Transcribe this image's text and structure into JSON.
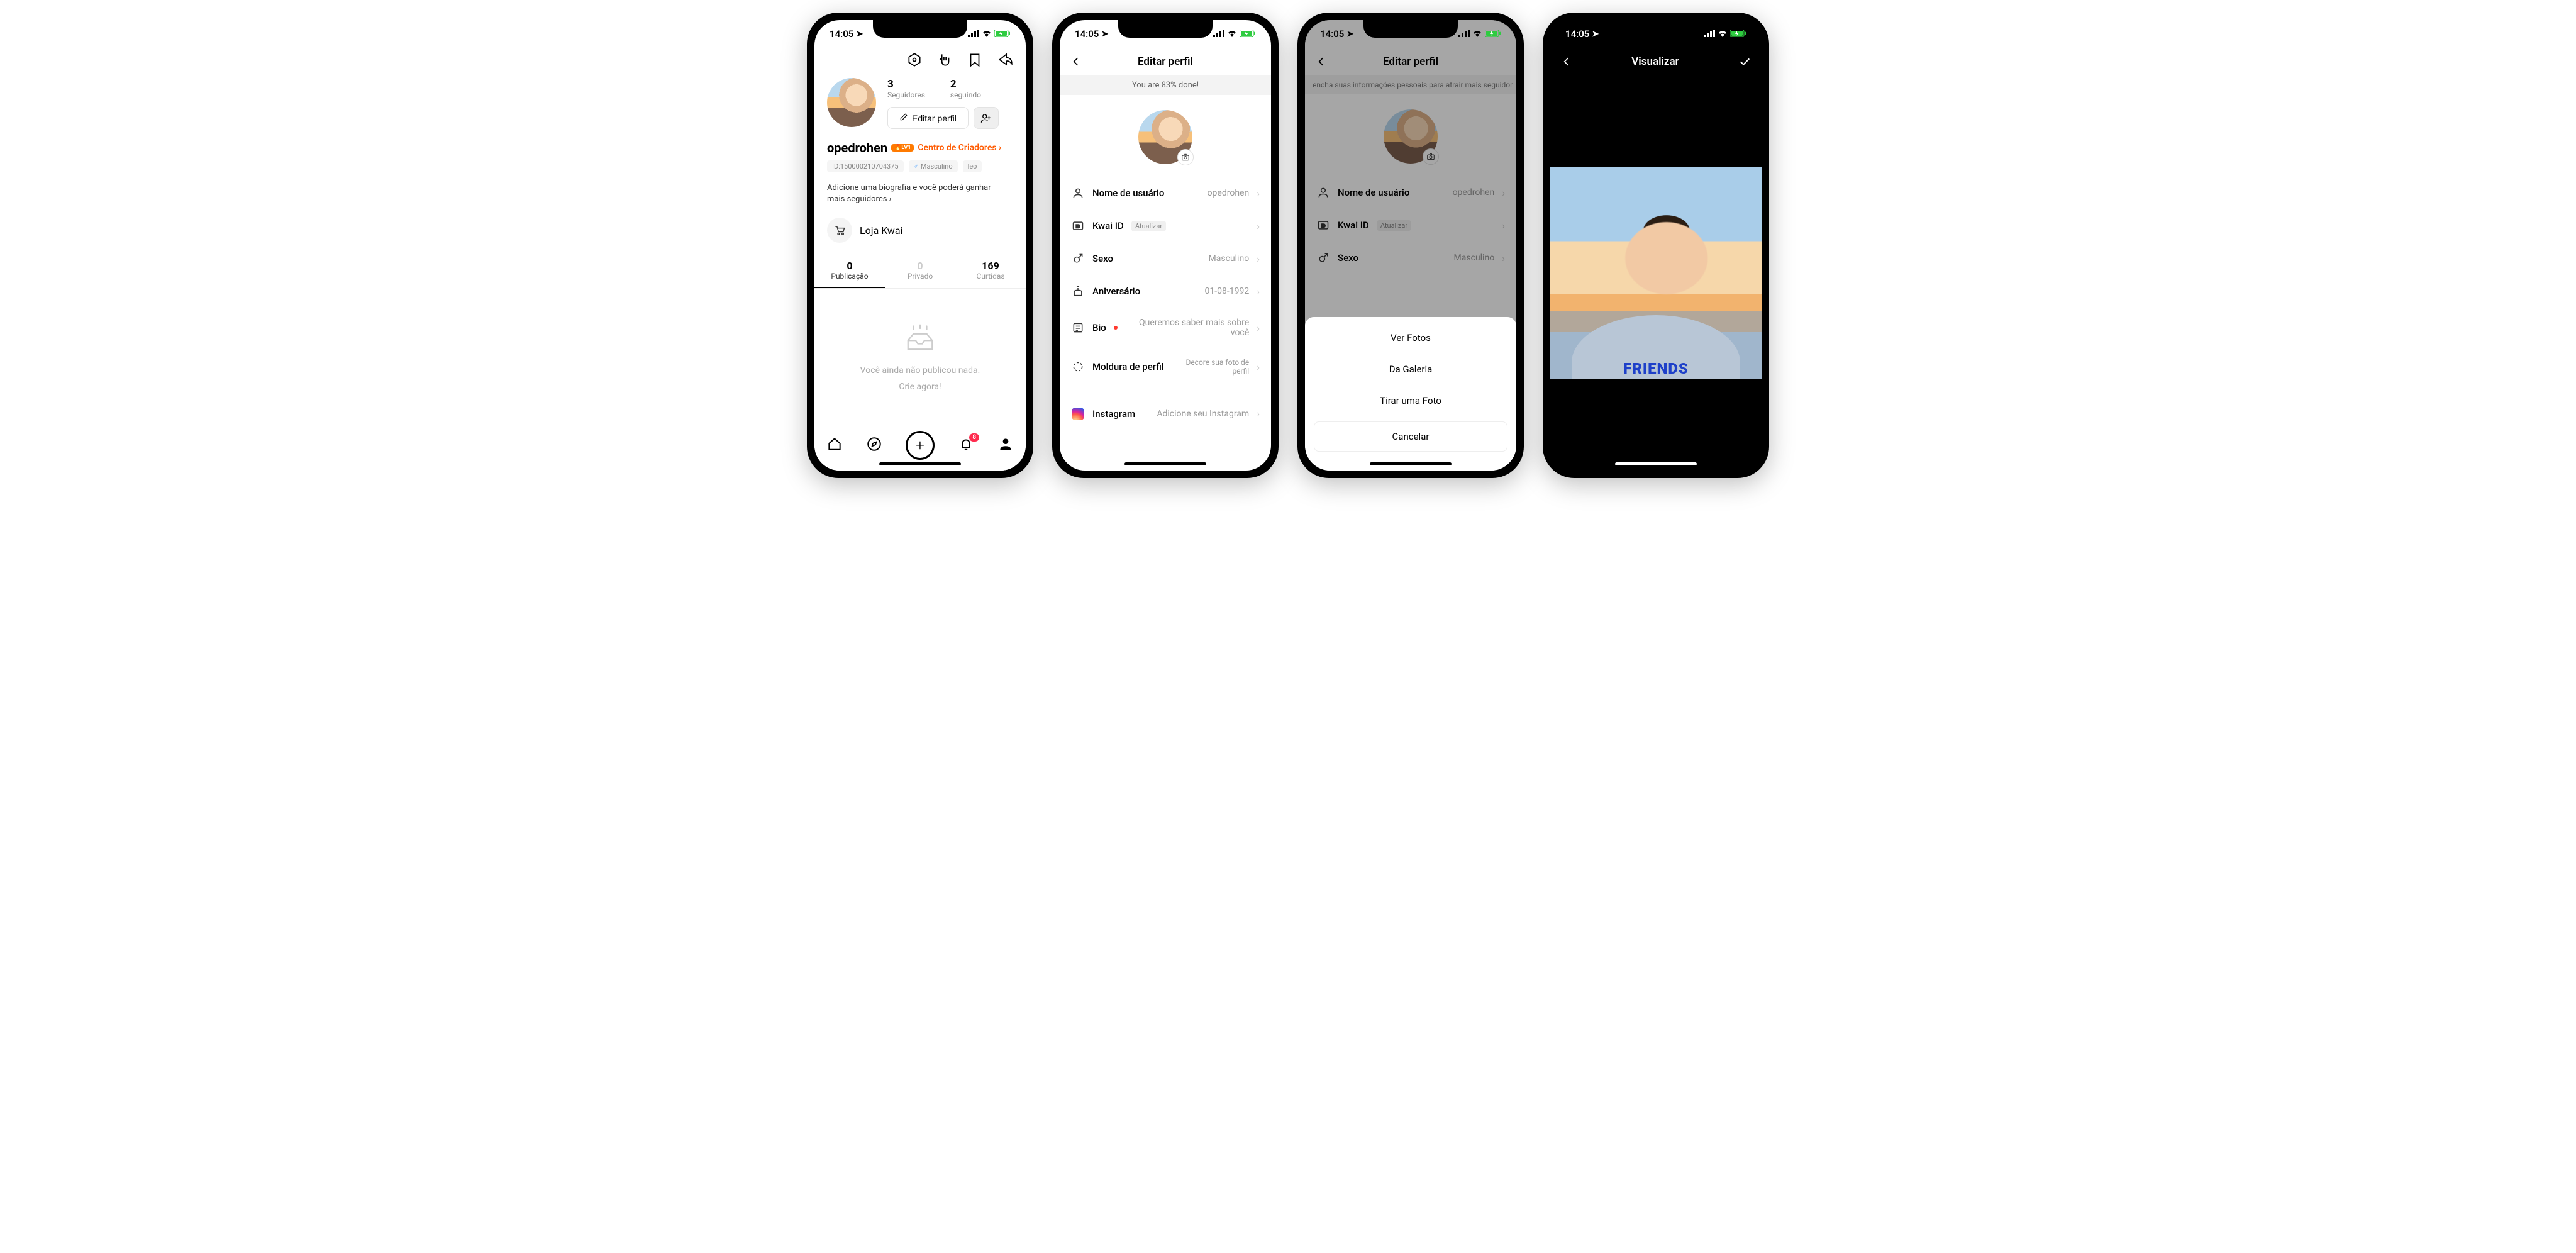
{
  "status": {
    "time": "14:05",
    "signal": "4",
    "wifi": true,
    "battery_charging": true
  },
  "screen1": {
    "stats": {
      "followers_n": "3",
      "followers_l": "Seguidores",
      "following_n": "2",
      "following_l": "seguindo"
    },
    "edit_label": "Editar perfil",
    "username": "opedrohen",
    "level_badge": "LV1",
    "creator_link": "Centro de Criadores ›",
    "id_tag": "ID:150000210704375",
    "gender_tag": "Masculino",
    "sign_tag": "leo",
    "bio_hint_l1": "Adicione uma biografia e você poderá ganhar",
    "bio_hint_l2": "mais seguidores ›",
    "store_label": "Loja Kwai",
    "tabs": {
      "pub_n": "0",
      "pub_l": "Publicação",
      "priv_n": "0",
      "priv_l": "Privado",
      "likes_n": "169",
      "likes_l": "Curtidas"
    },
    "empty_l1": "Você ainda não publicou nada.",
    "empty_l2": "Crie agora!",
    "notif_badge": "8"
  },
  "screen2": {
    "title": "Editar perfil",
    "banner": "You are 83% done!",
    "rows": {
      "username_l": "Nome de usuário",
      "username_v": "opedrohen",
      "kwai_l": "Kwai ID",
      "kwai_pill": "Atualizar",
      "sex_l": "Sexo",
      "sex_v": "Masculino",
      "bday_l": "Aniversário",
      "bday_v": "01-08-1992",
      "bio_l": "Bio",
      "bio_v": "Queremos saber mais sobre você",
      "frame_l": "Moldura de perfil",
      "frame_v": "Decore sua foto de perfil",
      "ig_l": "Instagram",
      "ig_v": "Adicione seu Instagram"
    }
  },
  "screen3": {
    "title": "Editar perfil",
    "banner": "encha suas informações pessoais para atrair mais seguidor",
    "sheet": {
      "opt1": "Ver Fotos",
      "opt2": "Da Galeria",
      "opt3": "Tirar uma Foto",
      "cancel": "Cancelar"
    }
  },
  "screen4": {
    "title": "Visualizar",
    "shirt_text": "FRIENDS"
  }
}
